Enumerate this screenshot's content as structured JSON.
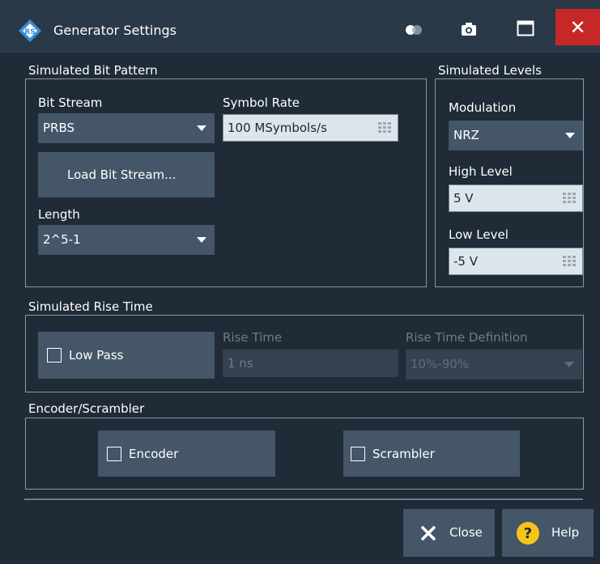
{
  "window": {
    "title": "Generator Settings",
    "close_glyph": "✕"
  },
  "bit_pattern": {
    "group_title": "Simulated Bit Pattern",
    "bit_stream_label": "Bit Stream",
    "bit_stream_value": "PRBS",
    "symbol_rate_label": "Symbol Rate",
    "symbol_rate_value": "100 MSymbols/s",
    "load_button": "Load Bit Stream...",
    "length_label": "Length",
    "length_value": "2^5-1"
  },
  "levels": {
    "group_title": "Simulated Levels",
    "modulation_label": "Modulation",
    "modulation_value": "NRZ",
    "high_label": "High Level",
    "high_value": "5 V",
    "low_label": "Low Level",
    "low_value": "-5 V"
  },
  "rise_time": {
    "group_title": "Simulated Rise Time",
    "low_pass_label": "Low Pass",
    "low_pass_checked": false,
    "rise_time_label": "Rise Time",
    "rise_time_value": "1 ns",
    "definition_label": "Rise Time Definition",
    "definition_value": "10%-90%"
  },
  "encoder": {
    "group_title": "Encoder/Scrambler",
    "encoder_label": "Encoder",
    "encoder_checked": false,
    "scrambler_label": "Scrambler",
    "scrambler_checked": false
  },
  "footer": {
    "close_label": "Close",
    "help_label": "Help"
  },
  "colors": {
    "background": "#1f2b36",
    "titlebar": "#2a3947",
    "control": "#445667",
    "close_red": "#c62828",
    "help_yellow": "#f5c518"
  },
  "icons": [
    "rs-logo-icon",
    "toggle-icon",
    "camera-icon",
    "maximize-icon",
    "close-icon",
    "keypad-icon",
    "dropdown-arrow-icon",
    "help-icon"
  ]
}
